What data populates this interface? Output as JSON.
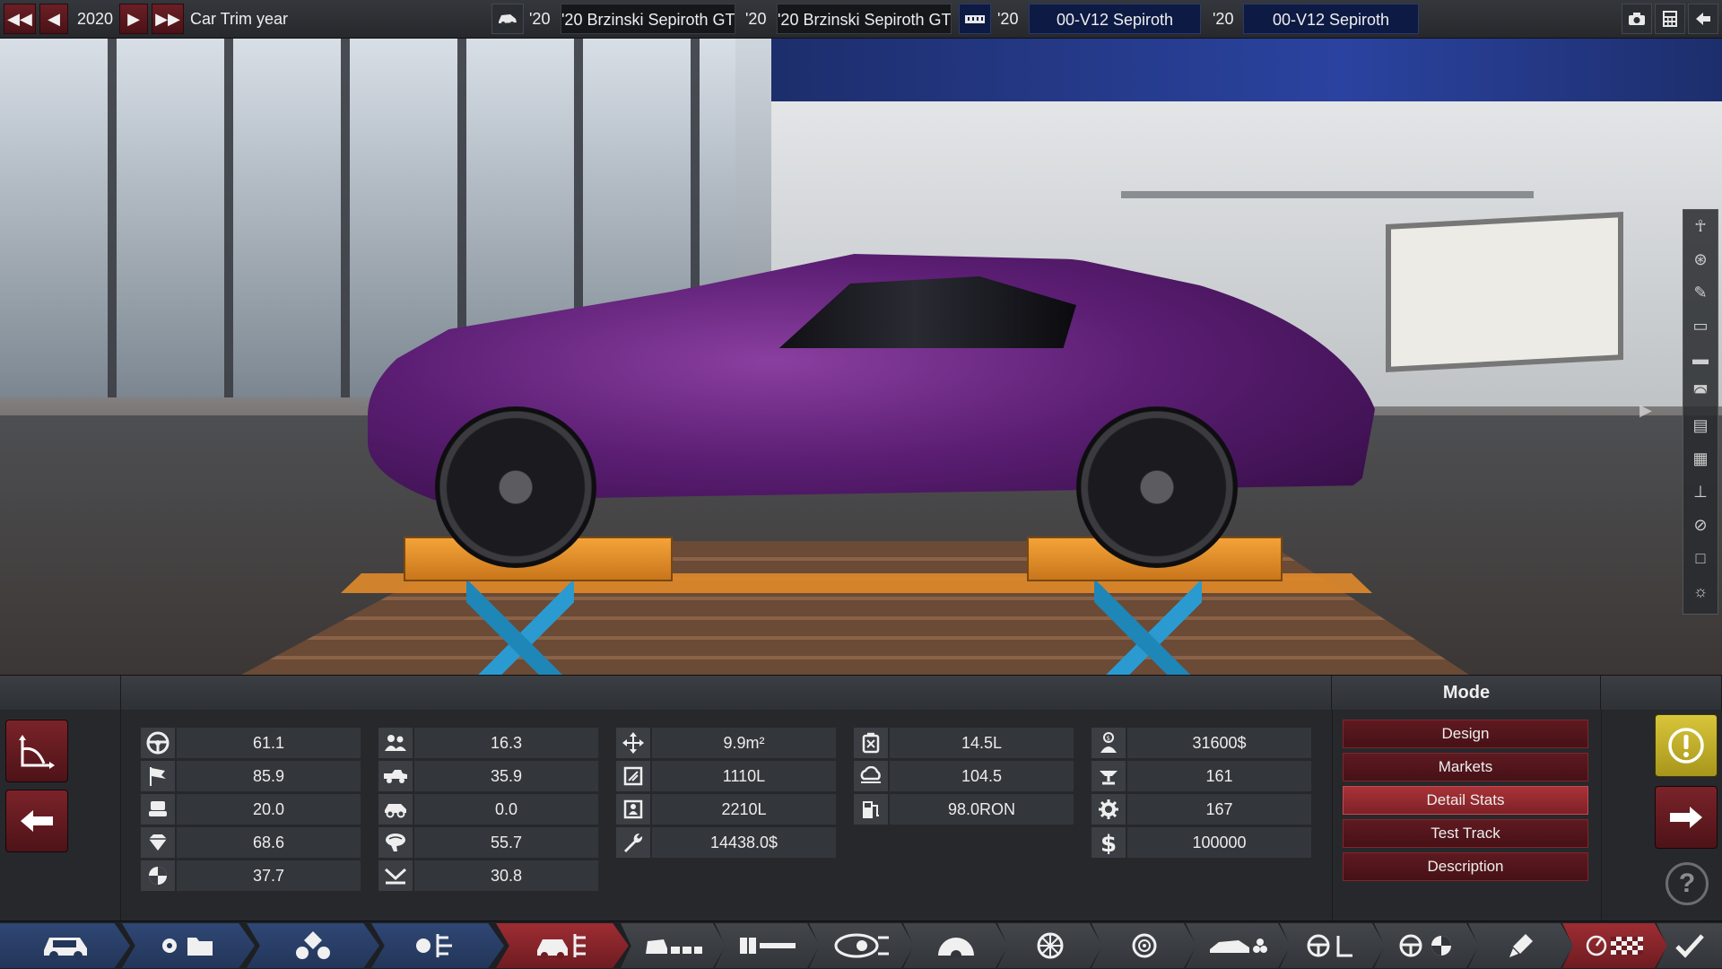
{
  "topbar": {
    "year": "2020",
    "year_label": "Car Trim year",
    "model_year_1": "'20",
    "model_name_1": "'20 Brzinski Sepiroth GT",
    "trim_year": "'20",
    "trim_name": "'20 Brzinski Sepiroth GT",
    "engine_year_1": "'20",
    "engine_name": "00-V12 Sepiroth",
    "engine_year_2": "'20",
    "variant_name": "00-V12 Sepiroth"
  },
  "mode": {
    "title": "Mode",
    "buttons": [
      {
        "label": "Design",
        "active": false
      },
      {
        "label": "Markets",
        "active": false
      },
      {
        "label": "Detail Stats",
        "active": true
      },
      {
        "label": "Test Track",
        "active": false
      },
      {
        "label": "Description",
        "active": false
      }
    ]
  },
  "stats": {
    "col1": [
      {
        "icon": "steering-wheel-icon",
        "value": "61.1"
      },
      {
        "icon": "checkered-flag-icon",
        "value": "85.9"
      },
      {
        "icon": "seat-icon",
        "value": "20.0"
      },
      {
        "icon": "diamond-icon",
        "value": "68.6"
      },
      {
        "icon": "pie-chart-icon",
        "value": "37.7"
      }
    ],
    "col2": [
      {
        "icon": "passengers-icon",
        "value": "16.3"
      },
      {
        "icon": "truck-icon",
        "value": "35.9"
      },
      {
        "icon": "offroad-car-icon",
        "value": "0.0"
      },
      {
        "icon": "brain-icon",
        "value": "55.7"
      },
      {
        "icon": "downforce-icon",
        "value": "30.8"
      }
    ],
    "col3": [
      {
        "icon": "move-arrows-icon",
        "value": "9.9m²"
      },
      {
        "icon": "box-icon",
        "value": "1110L"
      },
      {
        "icon": "person-box-icon",
        "value": "2210L"
      },
      {
        "icon": "wrench-cost-icon",
        "value": "14438.0$"
      }
    ],
    "col4": [
      {
        "icon": "fuel-tank-icon",
        "value": "14.5L"
      },
      {
        "icon": "emissions-cloud-icon",
        "value": "104.5"
      },
      {
        "icon": "fuel-pump-icon",
        "value": "98.0RON"
      }
    ],
    "col5": [
      {
        "icon": "money-person-icon",
        "value": "31600$"
      },
      {
        "icon": "production-icon",
        "value": "161"
      },
      {
        "icon": "gear-wrench-icon",
        "value": "167"
      },
      {
        "icon": "dollar-icon",
        "value": "100000"
      }
    ]
  },
  "colors": {
    "accent_red": "#7e2127",
    "accent_blue": "#2f4775",
    "warning_yellow": "#d8c53a"
  }
}
